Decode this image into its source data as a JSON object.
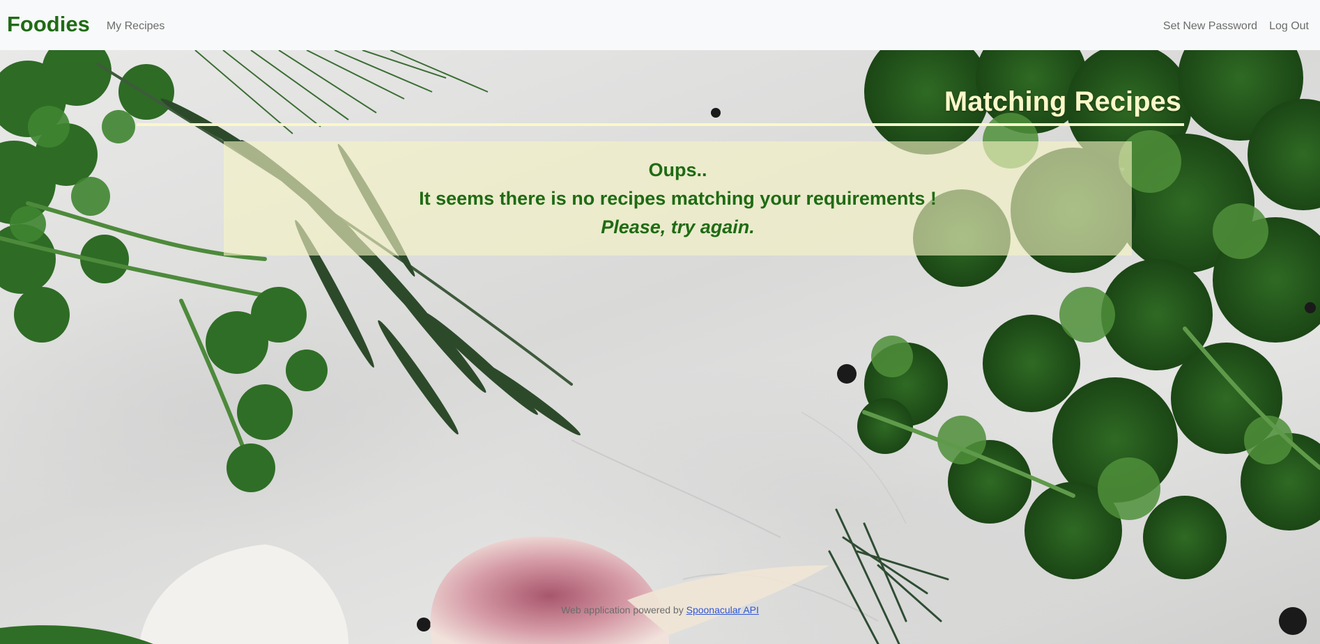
{
  "navbar": {
    "brand": "Foodies",
    "left_links": [
      "My Recipes"
    ],
    "right_links": [
      "Set New Password",
      "Log Out"
    ]
  },
  "main": {
    "title": "Matching Recipes",
    "message": {
      "line1": "Oups..",
      "line2": "It seems there is no recipes matching your requirements !",
      "line3": "Please, try again."
    }
  },
  "footer": {
    "text": "Web application powered by",
    "link_label": "Spoonacular API"
  },
  "colors": {
    "brand_green": "#1f6b14",
    "title_cream": "#fbf8c9",
    "navbar_bg": "#f8f9fa",
    "link_blue": "#2f57d6"
  }
}
